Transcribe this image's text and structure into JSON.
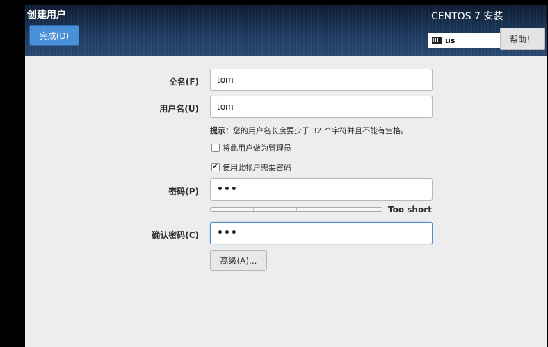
{
  "header": {
    "title": "创建用户",
    "done_label": "完成(D)",
    "product": "CENTOS 7 安装",
    "keyboard_layout": "us",
    "help_label": "帮助！"
  },
  "form": {
    "fullname": {
      "label": "全名(F)",
      "value": "tom"
    },
    "username": {
      "label": "用户名(U)",
      "value": "tom"
    },
    "hint": {
      "prefix": "提示：",
      "text": "您的用户名长度要少于 32 个字符并且不能有空格。"
    },
    "admin_checkbox": {
      "label": "将此用户做为管理员",
      "checked": false
    },
    "require_password_checkbox": {
      "label": "使用此帐户需要密码",
      "checked": true
    },
    "password": {
      "label": "密码(P)",
      "value": "•••"
    },
    "strength": {
      "text": "Too short",
      "level": 0
    },
    "confirm_password": {
      "label": "确认密码(C)",
      "value": "•••"
    },
    "advanced_label": "高级(A)..."
  },
  "colors": {
    "accent": "#4a90d9",
    "header_dark": "#0d1c33",
    "background": "#ededed"
  }
}
